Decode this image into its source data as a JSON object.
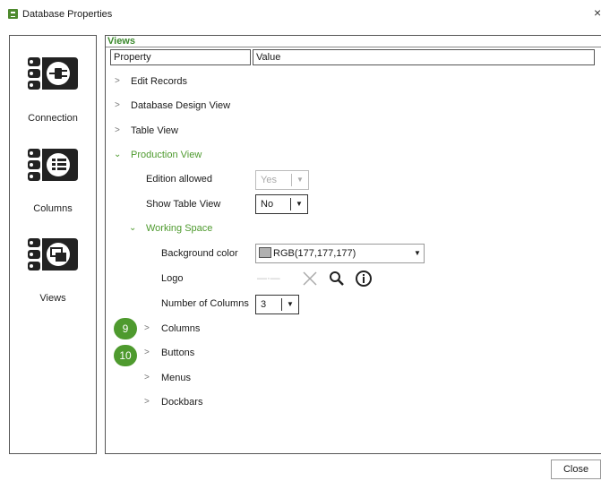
{
  "window": {
    "title": "Database Properties",
    "close_glyph": "×"
  },
  "sidebar": {
    "items": [
      {
        "label": "Connection",
        "icon": "server-plug-icon"
      },
      {
        "label": "Columns",
        "icon": "server-columns-icon"
      },
      {
        "label": "Views",
        "icon": "server-views-icon"
      }
    ]
  },
  "main": {
    "section_title": "Views",
    "headers": {
      "property": "Property",
      "value": "Value"
    },
    "rows": {
      "edit_records": "Edit Records",
      "design_view": "Database Design View",
      "table_view": "Table View",
      "production_view": "Production View",
      "edition_allowed": "Edition allowed",
      "edition_allowed_value": "Yes",
      "show_table_view": "Show Table View",
      "show_table_view_value": "No",
      "working_space": "Working Space",
      "background_color": "Background color",
      "background_color_value": "RGB(177,177,177)",
      "background_swatch": "#b1b1b1",
      "logo": "Logo",
      "logo_placeholder": "—·—",
      "number_of_columns": "Number of Columns",
      "number_of_columns_value": "3",
      "columns": "Columns",
      "buttons": "Buttons",
      "menus": "Menus",
      "dockbars": "Dockbars"
    },
    "badges": {
      "columns": "9",
      "buttons": "10"
    }
  },
  "footer": {
    "close_label": "Close"
  },
  "colors": {
    "accent_green": "#4e9a2e"
  }
}
